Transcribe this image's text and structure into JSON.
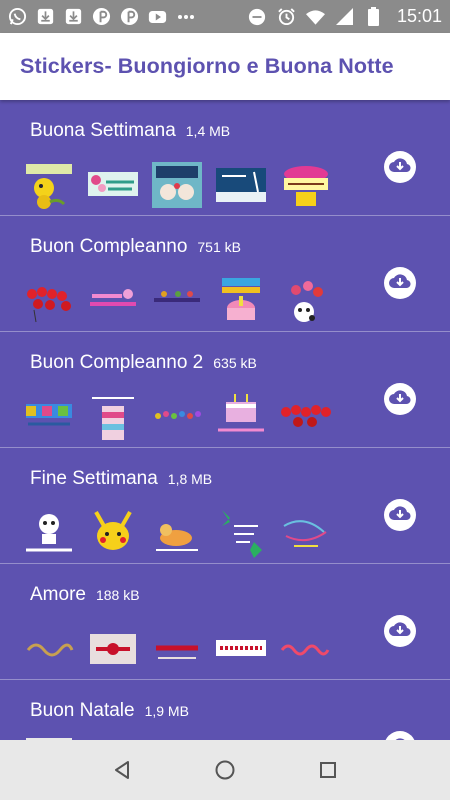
{
  "status_bar": {
    "time": "15:01",
    "left_icons": [
      "whatsapp-icon",
      "download-icon",
      "download-icon",
      "pinterest-icon",
      "pinterest-icon",
      "youtube-icon",
      "dots-icon"
    ],
    "right_icons": [
      "minus-circle-icon",
      "alarm-icon",
      "wifi-icon",
      "signal-icon",
      "battery-icon"
    ]
  },
  "app_bar": {
    "title": "Stickers- Buongiorno e Buona Notte"
  },
  "packs": [
    {
      "name": "Buona Settimana",
      "size": "1,4 MB"
    },
    {
      "name": "Buon Compleanno",
      "size": "751 kB"
    },
    {
      "name": "Buon Compleanno 2",
      "size": "635 kB"
    },
    {
      "name": "Fine Settimana",
      "size": "1,8 MB"
    },
    {
      "name": "Amore",
      "size": "188 kB"
    },
    {
      "name": "Buon Natale",
      "size": "1,9 MB"
    }
  ],
  "colors": {
    "accent": "#5d52b0",
    "status_bar": "#8b8b8b",
    "nav_bar": "#e8e8e8"
  },
  "nav_bar": {
    "icons": [
      "back-icon",
      "home-icon",
      "recents-icon"
    ]
  }
}
